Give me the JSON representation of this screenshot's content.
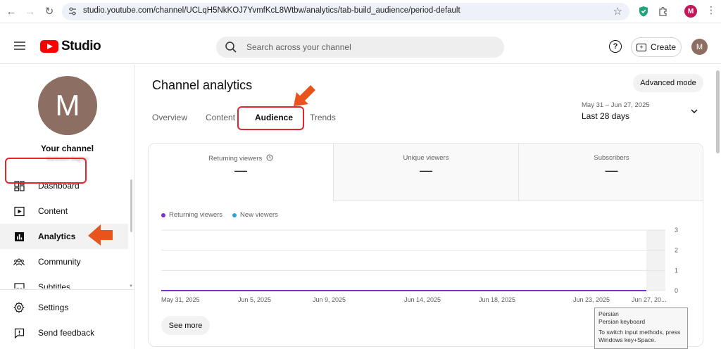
{
  "browser": {
    "url": "studio.youtube.com/channel/UCLqH5NkKOJ7YvmfKcL8Wtbw/analytics/tab-build_audience/period-default",
    "profile_initial": "M"
  },
  "header": {
    "logo_text": "Studio",
    "search_placeholder": "Search across your channel",
    "help_glyph": "?",
    "create_label": "Create",
    "avatar_initial": "M"
  },
  "sidebar": {
    "avatar_initial": "M",
    "your_channel": "Your channel",
    "channel_name": "Mahbubeh Bagheri",
    "items": [
      {
        "label": "Dashboard",
        "icon": "dashboard-icon"
      },
      {
        "label": "Content",
        "icon": "content-icon"
      },
      {
        "label": "Analytics",
        "icon": "analytics-icon",
        "active": true
      },
      {
        "label": "Community",
        "icon": "community-icon"
      },
      {
        "label": "Subtitles",
        "icon": "subtitles-icon"
      }
    ],
    "footer_items": [
      {
        "label": "Settings",
        "icon": "gear-icon"
      },
      {
        "label": "Send feedback",
        "icon": "feedback-icon"
      }
    ]
  },
  "main": {
    "title": "Channel analytics",
    "advanced_mode": "Advanced mode",
    "tabs": [
      {
        "label": "Overview"
      },
      {
        "label": "Content"
      },
      {
        "label": "Audience",
        "active": true
      },
      {
        "label": "Trends"
      }
    ],
    "date_range": "May 31 – Jun 27, 2025",
    "date_label": "Last 28 days",
    "metrics": [
      {
        "label": "Returning viewers",
        "value": "—",
        "active": true
      },
      {
        "label": "Unique viewers",
        "value": "—"
      },
      {
        "label": "Subscribers",
        "value": "—"
      }
    ],
    "see_more": "See more"
  },
  "chart_data": {
    "type": "line",
    "series": [
      {
        "name": "Returning viewers",
        "color": "#7b2fd1",
        "values": [
          0,
          0,
          0,
          0,
          0,
          0,
          0,
          0,
          0,
          0,
          0,
          0,
          0,
          0,
          0,
          0,
          0,
          0,
          0,
          0,
          0,
          0,
          0,
          0,
          0,
          0,
          0,
          0
        ]
      },
      {
        "name": "New viewers",
        "color": "#2aa3d4",
        "values": []
      }
    ],
    "x_tick_labels": [
      "May 31, 2025",
      "Jun 5, 2025",
      "Jun 9, 2025",
      "Jun 14, 2025",
      "Jun 18, 2025",
      "Jun 23, 2025",
      "Jun 27, 20..."
    ],
    "y_tick_labels": [
      "3",
      "2",
      "1",
      "0"
    ],
    "ylim": [
      0,
      3
    ],
    "grid": true
  },
  "ime_tooltip": {
    "line1": "Persian",
    "line2": "Persian keyboard",
    "line3": "To switch input methods, press Windows key+Space."
  },
  "colors": {
    "brand_red": "#ff0000",
    "highlight": "#e3262b",
    "arrow": "#e8541c"
  }
}
